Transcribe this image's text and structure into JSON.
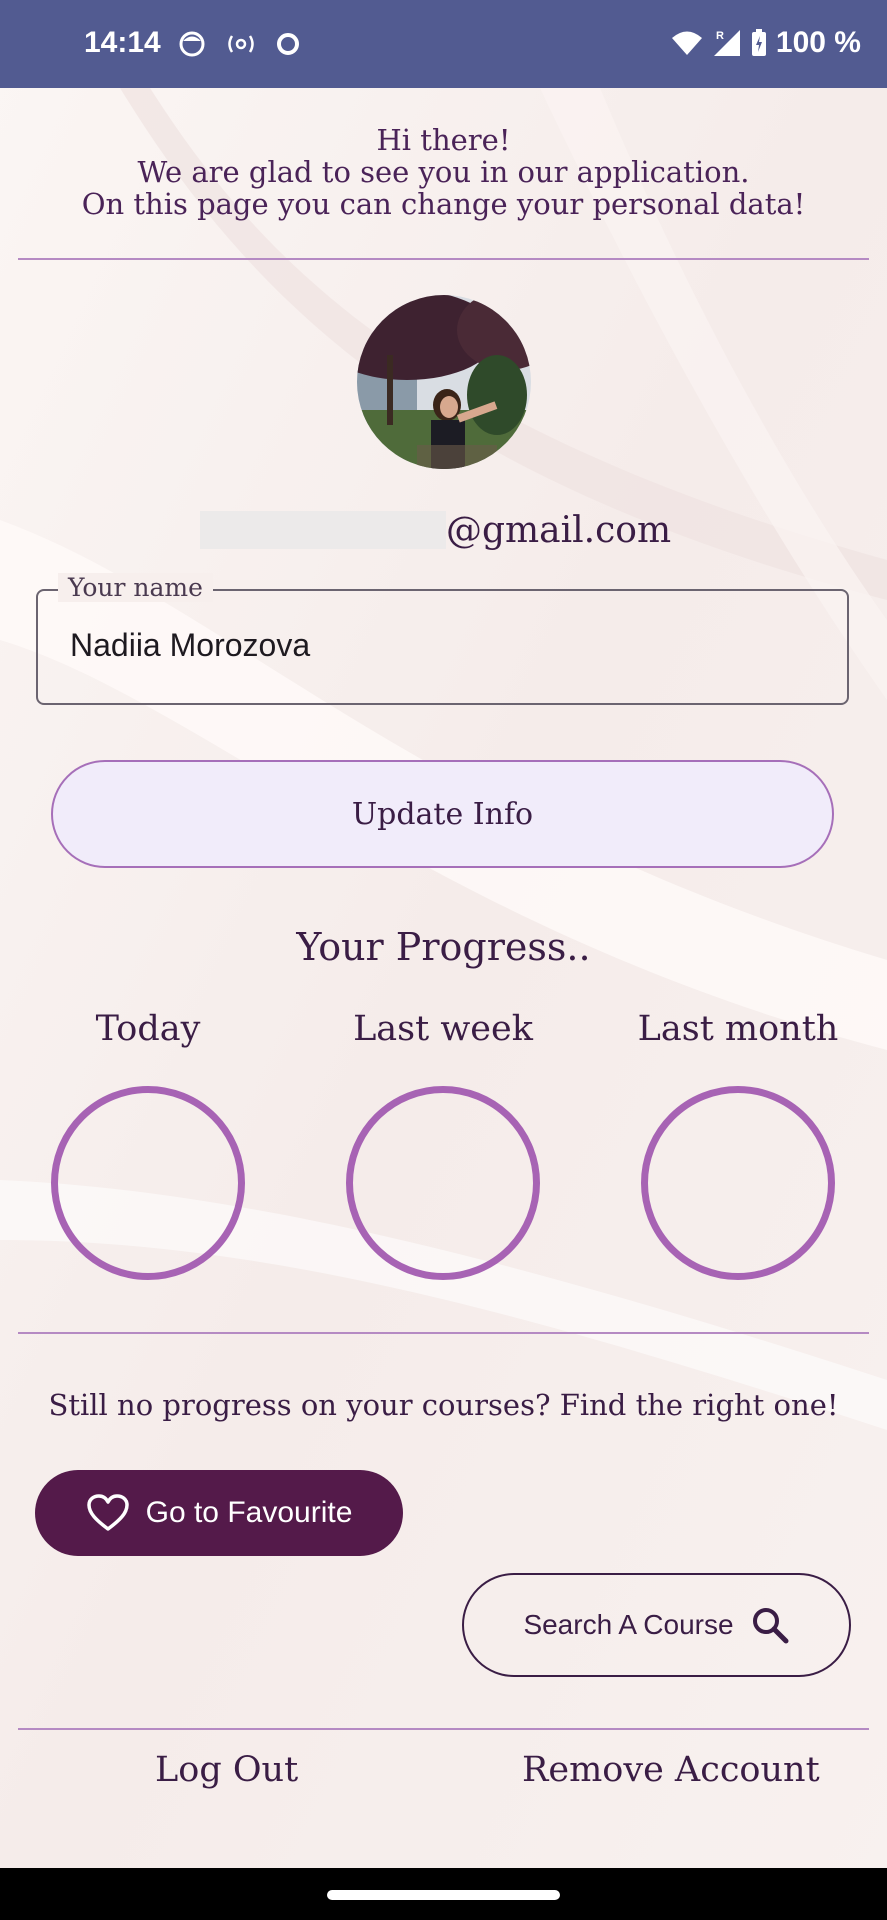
{
  "status_bar": {
    "time": "14:14",
    "battery": "100 %",
    "icons": [
      "face-icon",
      "radio-icon",
      "circle-icon",
      "wifi-icon",
      "signal-icon",
      "battery-icon"
    ]
  },
  "greeting": {
    "line1": "Hi there!",
    "line2": "We are glad to see you in our application.",
    "line3": "On this page you can change your personal data!"
  },
  "profile": {
    "avatar": "user-photo",
    "email_suffix": "@gmail.com"
  },
  "name_field": {
    "label": "Your name",
    "value": "Nadiia Morozova"
  },
  "update_button": "Update Info",
  "progress": {
    "title": "Your Progress..",
    "periods": [
      {
        "label": "Today"
      },
      {
        "label": "Last week"
      },
      {
        "label": "Last month"
      }
    ]
  },
  "cta": {
    "tagline": "Still no progress on your courses? Find the right one!",
    "favourite_button": "Go to Favourite",
    "search_button": "Search A Course"
  },
  "footer": {
    "logout": "Log Out",
    "remove": "Remove Account"
  },
  "colors": {
    "status_bar": "#525b91",
    "accent": "#a763b4",
    "primary_dark": "#541a4a",
    "text": "#3a1d45",
    "button_fill": "#f1ecfa"
  }
}
